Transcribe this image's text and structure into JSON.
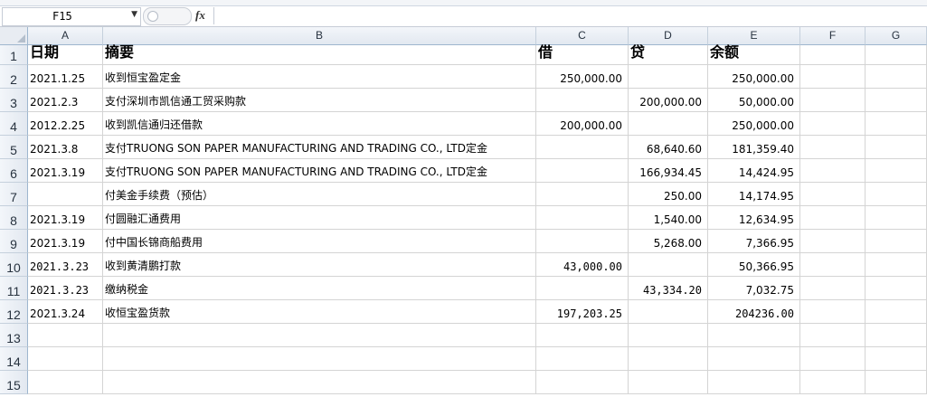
{
  "name_box": "F15",
  "formula_value": "",
  "columns": [
    "A",
    "B",
    "C",
    "D",
    "E",
    "F",
    "G"
  ],
  "row_numbers": [
    "1",
    "2",
    "3",
    "4",
    "5",
    "6",
    "7",
    "8",
    "9",
    "10",
    "11",
    "12",
    "13",
    "14",
    "15"
  ],
  "headers": {
    "date": "日期",
    "summary": "摘要",
    "debit": "借",
    "credit": "贷",
    "balance": "余额"
  },
  "rows": [
    {
      "date": "2021.1.25",
      "summary": "收到恒宝盈定金",
      "debit": "250,000.00",
      "credit": "",
      "balance": "250,000.00"
    },
    {
      "date": "2021.2.3",
      "summary": "支付深圳市凯信通工贸采购款",
      "debit": "",
      "credit": "200,000.00",
      "balance": "50,000.00"
    },
    {
      "date": "2012.2.25",
      "summary": "收到凯信通归还借款",
      "debit": "200,000.00",
      "credit": "",
      "balance": "250,000.00"
    },
    {
      "date": "2021.3.8",
      "summary": "支付TRUONG SON PAPER MANUFACTURING AND TRADING CO., LTD定金",
      "debit": "",
      "credit": "68,640.60",
      "balance": "181,359.40"
    },
    {
      "date": "2021.3.19",
      "summary": "支付TRUONG SON PAPER MANUFACTURING AND TRADING CO., LTD定金",
      "debit": "",
      "credit": "166,934.45",
      "balance": "14,424.95"
    },
    {
      "date": "",
      "summary": "付美金手续费（预估）",
      "debit": "",
      "credit": "250.00",
      "balance": "14,174.95"
    },
    {
      "date": "2021.3.19",
      "summary": "付圆融汇通费用",
      "debit": "",
      "credit": "1,540.00",
      "balance": "12,634.95"
    },
    {
      "date": "2021.3.19",
      "summary": "付中国长锦商船费用",
      "debit": "",
      "credit": "5,268.00",
      "balance": "7,366.95"
    },
    {
      "date": "2021.3.23",
      "summary": "收到黄清鹏打款",
      "debit": "43,000.00",
      "credit": "",
      "balance": "50,366.95"
    },
    {
      "date": "2021.3.23",
      "summary": "缴纳税金",
      "debit": "",
      "credit": "43,334.20",
      "balance": "7,032.75"
    },
    {
      "date": "2021.3.24",
      "summary": "收恒宝盈货款",
      "debit": "197,203.25",
      "credit": "",
      "balance": "204236.00"
    }
  ]
}
